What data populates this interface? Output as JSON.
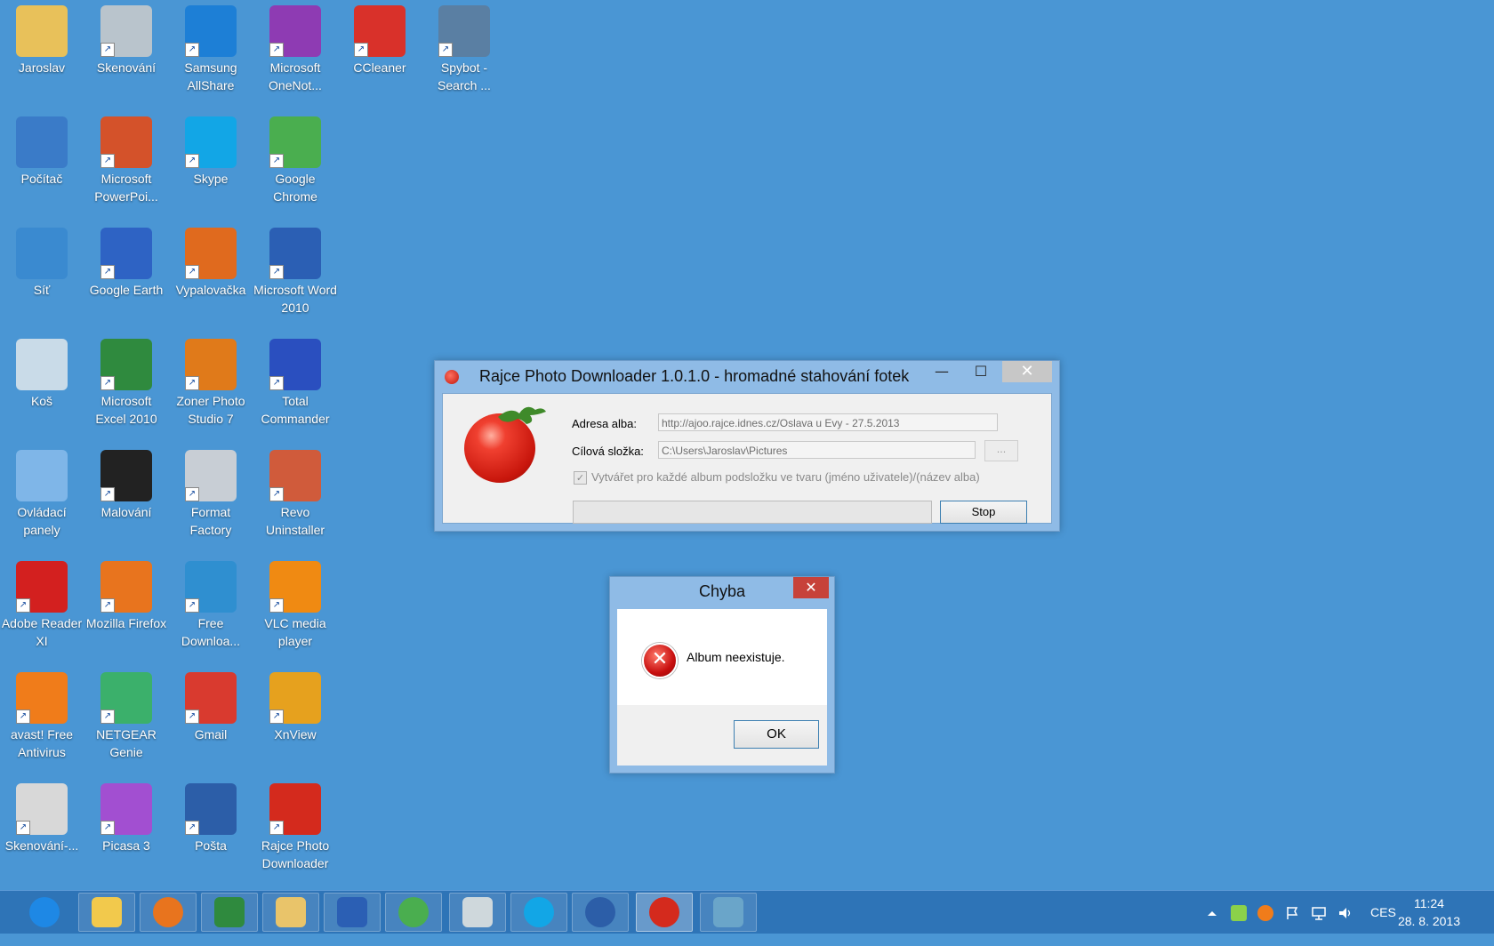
{
  "desktop": {
    "icons": [
      {
        "label": "Jaroslav",
        "icon": "user-folder-icon",
        "color": "#e8c15a"
      },
      {
        "label": "Skenování",
        "icon": "scan-icon",
        "color": "#b9c4cc"
      },
      {
        "label": "Samsung AllShare",
        "icon": "samsung-allshare-icon",
        "color": "#1d7fd6"
      },
      {
        "label": "Microsoft OneNot...",
        "icon": "onenote-icon",
        "color": "#8e3bb3"
      },
      {
        "label": "CCleaner",
        "icon": "ccleaner-icon",
        "color": "#d9312a"
      },
      {
        "label": "Spybot - Search ...",
        "icon": "spybot-icon",
        "color": "#5a7fa3"
      },
      {
        "label": "Počítač",
        "icon": "computer-icon",
        "color": "#3a7bc8"
      },
      {
        "label": "Microsoft PowerPoi...",
        "icon": "powerpoint-icon",
        "color": "#d4522a"
      },
      {
        "label": "Skype",
        "icon": "skype-icon",
        "color": "#12a6e6"
      },
      {
        "label": "Google Chrome",
        "icon": "chrome-icon",
        "color": "#4aae4f"
      },
      {
        "label": "Síť",
        "icon": "network-icon",
        "color": "#3a8ad0"
      },
      {
        "label": "Google Earth",
        "icon": "google-earth-icon",
        "color": "#2e63c4"
      },
      {
        "label": "Vypalovačka",
        "icon": "burner-icon",
        "color": "#e06a1e"
      },
      {
        "label": "Microsoft Word 2010",
        "icon": "word-icon",
        "color": "#2b5fb4"
      },
      {
        "label": "Koš",
        "icon": "recycle-bin-icon",
        "color": "#c9dbe8"
      },
      {
        "label": "Microsoft Excel 2010",
        "icon": "excel-icon",
        "color": "#2f8a3e"
      },
      {
        "label": "Zoner Photo Studio 7",
        "icon": "zoner-icon",
        "color": "#e07a1a"
      },
      {
        "label": "Total Commander",
        "icon": "floppy-icon",
        "color": "#2a4fbf"
      },
      {
        "label": "Ovládací panely",
        "icon": "control-panel-icon",
        "color": "#7fb6e8"
      },
      {
        "label": "Malování",
        "icon": "inkscape-icon",
        "color": "#222222"
      },
      {
        "label": "Format Factory",
        "icon": "format-factory-icon",
        "color": "#c8ced5"
      },
      {
        "label": "Revo Uninstaller",
        "icon": "revo-uninstaller-icon",
        "color": "#d05b3b"
      },
      {
        "label": "Adobe Reader XI",
        "icon": "adobe-reader-icon",
        "color": "#d3201f"
      },
      {
        "label": "Mozilla Firefox",
        "icon": "firefox-icon",
        "color": "#e8741e"
      },
      {
        "label": "Free Downloa...",
        "icon": "download-icon",
        "color": "#2f8fd0"
      },
      {
        "label": "VLC media player",
        "icon": "vlc-icon",
        "color": "#f08a12"
      },
      {
        "label": "avast! Free Antivirus",
        "icon": "avast-icon",
        "color": "#f07c1a"
      },
      {
        "label": "NETGEAR Genie",
        "icon": "netgear-genie-icon",
        "color": "#3bb06b"
      },
      {
        "label": "Gmail",
        "icon": "gmail-icon",
        "color": "#d93a2f"
      },
      {
        "label": "XnView",
        "icon": "xnview-icon",
        "color": "#e6a11e"
      },
      {
        "label": "Skenování-...",
        "icon": "help-scan-icon",
        "color": "#d8d8d8"
      },
      {
        "label": "Picasa 3",
        "icon": "picasa-icon",
        "color": "#a24fd1"
      },
      {
        "label": "Pošta",
        "icon": "thunderbird-icon",
        "color": "#2c5ea8"
      },
      {
        "label": "Rajce Photo Downloader",
        "icon": "tomato-icon",
        "color": "#d42a1d"
      }
    ]
  },
  "main_window": {
    "title": "Rajce Photo Downloader 1.0.1.0 - hromadné stahování fotek",
    "minimize": "—",
    "maximize": "☐",
    "close": "✕",
    "address_label": "Adresa alba:",
    "address_value": "http://ajoo.rajce.idnes.cz/Oslava u Evy - 27.5.2013",
    "folder_label": "Cílová složka:",
    "folder_value": "C:\\Users\\Jaroslav\\Pictures",
    "browse_label": "...",
    "checkbox_label": "Vytvářet pro každé album podsložku ve tvaru (jméno uživatele)/(název alba)",
    "checkbox_checked": true,
    "stop_label": "Stop"
  },
  "error_dialog": {
    "title": "Chyba",
    "close": "✕",
    "message": "Album neexistuje.",
    "ok_label": "OK"
  },
  "taskbar": {
    "items": [
      {
        "icon": "internet-explorer-icon",
        "color": "#1e88e5",
        "state": "plain"
      },
      {
        "icon": "file-explorer-icon",
        "color": "#f2c94c",
        "state": "pinned"
      },
      {
        "icon": "firefox-icon",
        "color": "#e8741e",
        "state": "pinned"
      },
      {
        "icon": "excel-icon",
        "color": "#2f8a3e",
        "state": "pinned"
      },
      {
        "icon": "outlook-icon",
        "color": "#e9c46a",
        "state": "pinned"
      },
      {
        "icon": "word-icon",
        "color": "#2b5fb4",
        "state": "pinned"
      },
      {
        "icon": "chrome-icon",
        "color": "#4aae4f",
        "state": "pinned"
      },
      {
        "icon": "paint-icon",
        "color": "#cfd8dc",
        "state": "pinned"
      },
      {
        "icon": "skype-icon",
        "color": "#12a6e6",
        "state": "pinned"
      },
      {
        "icon": "thunderbird-icon",
        "color": "#2c5ea8",
        "state": "pinned"
      },
      {
        "icon": "tomato-icon",
        "color": "#d42a1d",
        "state": "active"
      },
      {
        "icon": "photo-viewer-icon",
        "color": "#6aa5c9",
        "state": "pinned"
      }
    ],
    "tray": {
      "language": "CES",
      "time": "11:24",
      "date": "28. 8. 2013"
    }
  }
}
